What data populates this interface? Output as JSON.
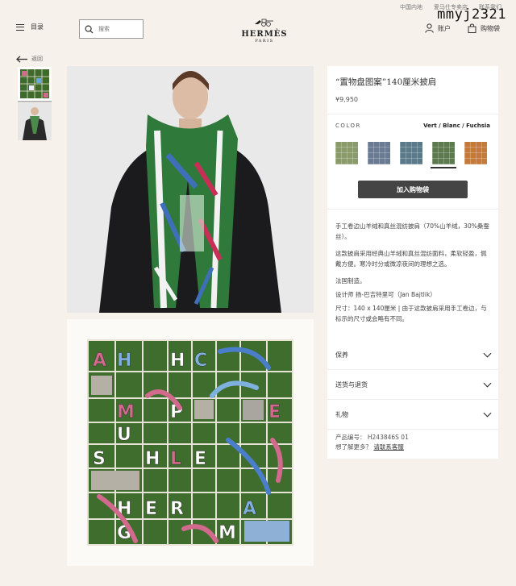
{
  "utility": {
    "region": "中国内地",
    "service": "爱马仕专卖店",
    "contact": "联系我们"
  },
  "watermark": "mmyj2321",
  "header": {
    "menu_label": "目录",
    "search_placeholder": "搜索",
    "logo_brand": "HERMÈS",
    "logo_city": "PARIS",
    "account_label": "账户",
    "cart_label": "购物袋"
  },
  "nav": {
    "back_label": "返回"
  },
  "product": {
    "title": "“置物盘图案”140厘米披肩",
    "price": "¥9,950",
    "color_label": "COLOR",
    "color_name": "Vert / Blanc / Fuchsia",
    "swatches": [
      "#8a9b6a",
      "#6b7a93",
      "#5a7a8a",
      "#5d7a4f",
      "#c47a3a"
    ],
    "selected_swatch_index": 3,
    "add_to_cart": "加入购物袋",
    "description": [
      "手工卷边山羊绒和真丝混纺披肩（70%山羊绒，30%桑蚕丝）。",
      "这款披肩采用经典山羊绒和真丝混纺面料，柔软轻盈，佩戴方便。寒冷时分或微凉夜间的理想之选。",
      "法国制造。",
      "设计师 扬-巴吉特里可（Jan Bajtlik）",
      "尺寸：140 x 140厘米 | 由于这款披肩采用手工卷边，与标示的尺寸或会略有不同。"
    ]
  },
  "accordion": [
    "保养",
    "送货与退货",
    "礼物"
  ],
  "meta": {
    "sku_label": "产品编号：",
    "sku": "H243846S 01",
    "more_label": "想了解更多？",
    "contact_link": "请联系客服"
  }
}
